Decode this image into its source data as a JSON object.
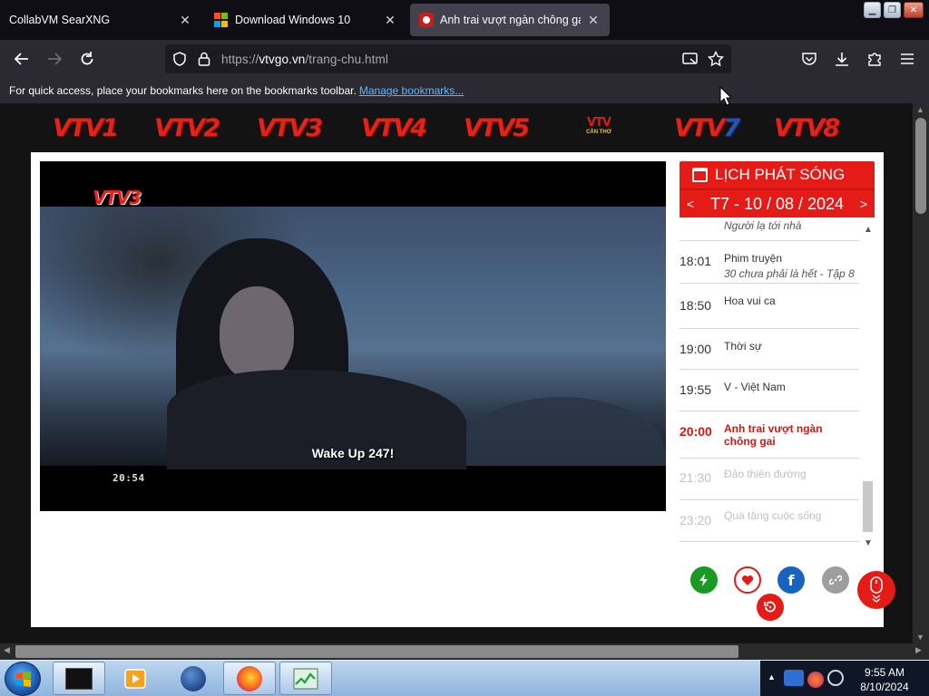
{
  "browser": {
    "tabs": [
      {
        "title": "CollabVM SearXNG",
        "active": false
      },
      {
        "title": "Download Windows 10",
        "active": false
      },
      {
        "title": "Anh trai vượt ngàn chông gai -",
        "active": true
      }
    ],
    "url": {
      "scheme": "https://",
      "host": "vtvgo.vn",
      "path": "/trang-chu.html"
    },
    "bookmarks_bar": {
      "message": "For quick access, place your bookmarks here on the bookmarks toolbar.",
      "link": "Manage bookmarks..."
    }
  },
  "page": {
    "channels": [
      {
        "num": "1",
        "color": "red"
      },
      {
        "num": "2",
        "color": "red"
      },
      {
        "num": "3",
        "color": "red"
      },
      {
        "num": "4",
        "color": "red"
      },
      {
        "num": "5",
        "color": "red"
      },
      {
        "label": "VTV",
        "sub": "CẦN THƠ"
      },
      {
        "num": "7",
        "color": "blue"
      },
      {
        "num": "8",
        "color": "red"
      }
    ],
    "video": {
      "channel_logo_num": "3",
      "subtitle": "Wake Up 247!",
      "timestamp": "20:54"
    },
    "schedule": {
      "title": "LỊCH PHÁT SÓNG",
      "date": "T7 - 10 / 08 / 2024",
      "prev": "<",
      "next": ">",
      "first_partial": "Người lạ tới nhà",
      "items": [
        {
          "time": "18:01",
          "name": "Phim truyện",
          "sub": "30 chưa phải là hết - Tập 8",
          "state": "normal"
        },
        {
          "time": "18:50",
          "name": "Hoa vui ca",
          "sub": "",
          "state": "normal"
        },
        {
          "time": "19:00",
          "name": "Thời sự",
          "sub": "",
          "state": "normal"
        },
        {
          "time": "19:55",
          "name": "V - Việt Nam",
          "sub": "",
          "state": "normal"
        },
        {
          "time": "20:00",
          "name": "Anh trai vượt ngàn chông gai",
          "sub": "",
          "state": "live"
        },
        {
          "time": "21:30",
          "name": "Đảo thiên đường",
          "sub": "",
          "state": "faded"
        },
        {
          "time": "23:20",
          "name": "Quà tặng cuộc sống",
          "sub": "",
          "state": "faded"
        }
      ]
    },
    "actions": [
      {
        "icon": "lightning-icon",
        "color": "#1a9a22"
      },
      {
        "icon": "heart-icon",
        "color": "#e41b17"
      },
      {
        "icon": "facebook-icon",
        "color": "#1565c0"
      },
      {
        "icon": "link-icon",
        "color": "#9e9e9e"
      }
    ]
  },
  "taskbar": {
    "time": "9:55 AM",
    "date": "8/10/2024"
  },
  "colors": {
    "brand_red": "#e41b17",
    "browser_bg": "#2b2a33",
    "link": "#5fb6ff"
  }
}
